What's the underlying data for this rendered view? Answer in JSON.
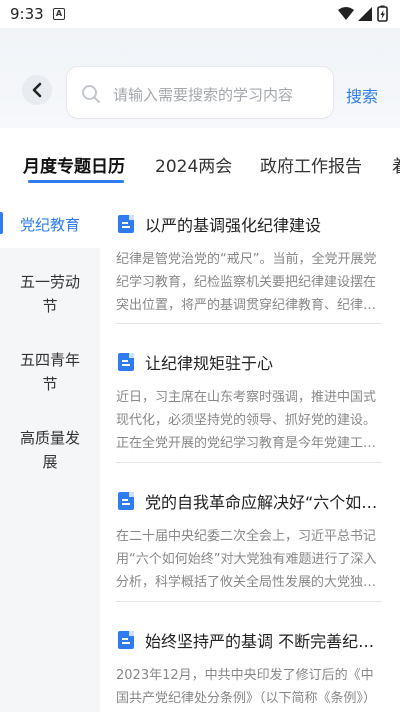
{
  "status_bar": {
    "time": "9:33",
    "notification_badge": "A"
  },
  "header": {
    "search_placeholder": "请输入需要搜索的学习内容",
    "search_button": "搜索"
  },
  "tabs": [
    {
      "label": "月度专题日历",
      "active": true
    },
    {
      "label": "2024两会",
      "active": false
    },
    {
      "label": "政府工作报告",
      "active": false
    },
    {
      "label": "着",
      "active": false
    }
  ],
  "sidebar": {
    "items": [
      {
        "label": "党纪教育",
        "active": true
      },
      {
        "label": "五一劳动节",
        "active": false
      },
      {
        "label": "五四青年节",
        "active": false
      },
      {
        "label": "高质量发展",
        "active": false
      }
    ]
  },
  "articles": [
    {
      "title": "以严的基调强化纪律建设",
      "summary": "纪律是管党治党的“戒尺”。当前，全党开展党纪学习教育，纪检监察机关要把纪律建设摆在突出位置，将严的基调贯穿纪律教育、纪律执行全过程"
    },
    {
      "title": "让纪律规矩驻于心",
      "summary": "近日，习主席在山东考察时强调，推进中国式现代化，必须坚持党的领导、抓好党的建设。正在全党开展的党纪学习教育是今年党建工作的重点"
    },
    {
      "title": "党的自我革命应解决好“六个如何始终”",
      "summary": "在二十届中央纪委二次全会上，习近平总书记用“六个如何始终”对大党独有难题进行了深入分析，科学概括了攸关全局性发展的大党独有难题"
    },
    {
      "title": "始终坚持严的基调 不断完善纪律建设",
      "summary": "2023年12月，中共中央印发了修订后的《中国共产党纪律处分条例》（以下简称《条例》）"
    }
  ],
  "colors": {
    "accent": "#2f7cf0",
    "sidebar_bg": "#f5f6f8",
    "muted_text": "#888888"
  }
}
